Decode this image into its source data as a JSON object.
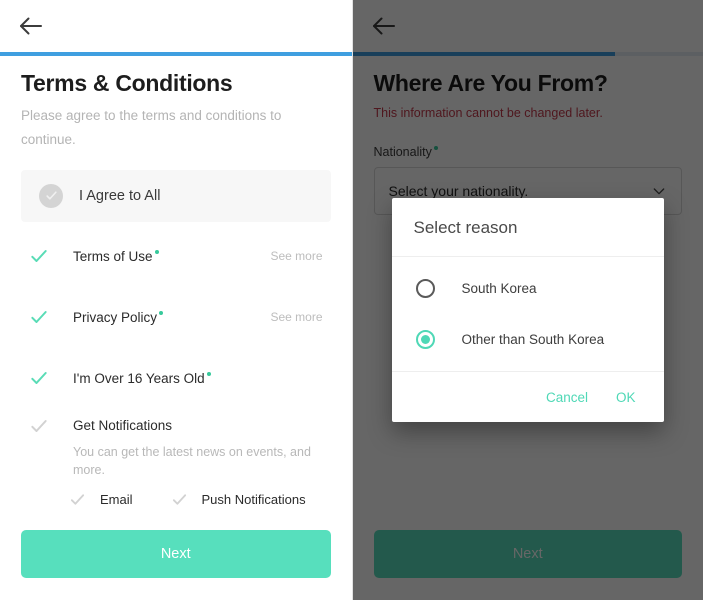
{
  "colors": {
    "accent_teal": "#57dfbd",
    "progress_blue": "#3f9fe0",
    "warning_red": "#c53a4d",
    "muted_gray": "#b4b4b4"
  },
  "left_screen": {
    "back_icon": "arrow-left-icon",
    "progress_percent": 100,
    "title": "Terms & Conditions",
    "subtitle": "Please agree to the terms and conditions to continue.",
    "agree_all": {
      "label": "I Agree to All",
      "icon": "check-circle-icon",
      "checked": false
    },
    "terms": [
      {
        "label": "Terms of Use",
        "required": true,
        "checked": true,
        "action": "See more"
      },
      {
        "label": "Privacy Policy",
        "required": true,
        "checked": true,
        "action": "See more"
      },
      {
        "label": "I'm Over 16 Years Old",
        "required": true,
        "checked": true,
        "action": ""
      }
    ],
    "notifications": {
      "title": "Get Notifications",
      "checked": false,
      "description": "You can get the latest news on events, and more.",
      "options": [
        {
          "label": "Email",
          "checked": false
        },
        {
          "label": "Push Notifications",
          "checked": false
        }
      ]
    },
    "cta_label": "Next"
  },
  "right_screen": {
    "back_icon": "arrow-left-icon",
    "progress_percent": 75,
    "title": "Where Are You From?",
    "warning": "This information cannot be changed later.",
    "field": {
      "label": "Nationality",
      "required": true,
      "value": "Select your nationality.",
      "chevron_icon": "chevron-down-icon"
    },
    "cta_label": "Next",
    "dialog": {
      "title": "Select reason",
      "options": [
        {
          "label": "South Korea",
          "selected": false
        },
        {
          "label": "Other than South Korea",
          "selected": true
        }
      ],
      "cancel_label": "Cancel",
      "ok_label": "OK"
    }
  }
}
